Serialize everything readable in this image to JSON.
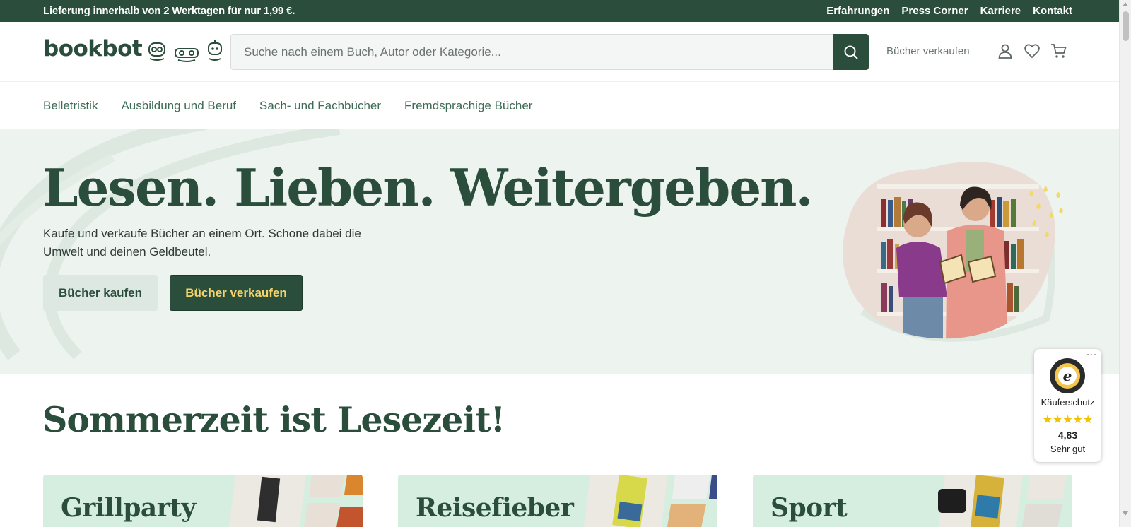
{
  "topbar": {
    "promo": "Lieferung innerhalb von 2 Werktagen für nur 1,99 €.",
    "links": [
      "Erfahrungen",
      "Press Corner",
      "Karriere",
      "Kontakt"
    ]
  },
  "header": {
    "logo": "bookbot",
    "search_placeholder": "Suche nach einem Buch, Autor oder Kategorie...",
    "sell_link": "Bücher verkaufen",
    "icons": [
      "user-icon",
      "heart-icon",
      "cart-icon",
      "search-icon"
    ]
  },
  "nav": {
    "items": [
      "Belletristik",
      "Ausbildung und Beruf",
      "Sach- und Fachbücher",
      "Fremdsprachige Bücher"
    ]
  },
  "hero": {
    "title": "Lesen. Lieben. Weitergeben.",
    "subtitle": "Kaufe und verkaufe Bücher an einem Ort. Schone dabei die Umwelt und deinen Geldbeutel.",
    "buy_button": "Bücher kaufen",
    "sell_button": "Bücher verkaufen"
  },
  "section": {
    "title": "Sommerzeit ist Lesezeit!",
    "cards": [
      "Grillparty",
      "Reisefieber",
      "Sport"
    ]
  },
  "trust_badge": {
    "label": "Käuferschutz",
    "stars": "★★★★★",
    "score": "4,83",
    "rating_text": "Sehr gut",
    "menu": "···"
  },
  "colors": {
    "brand_dark": "#2a4d3c",
    "hero_bg": "#edf3ef",
    "card_bg": "#d6eedf",
    "accent_yellow": "#f6d36a"
  }
}
